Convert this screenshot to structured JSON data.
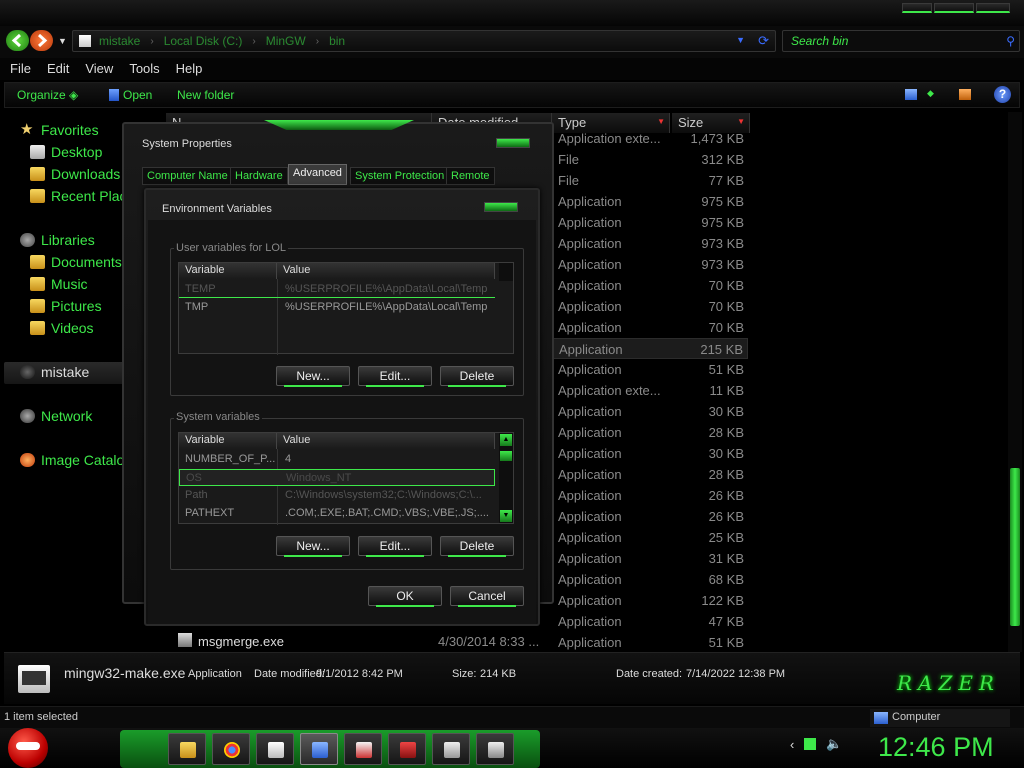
{
  "address": {
    "crumbs": [
      "mistake",
      "Local Disk (C:)",
      "MinGW",
      "bin"
    ],
    "search_placeholder": "Search bin"
  },
  "menu": [
    "File",
    "Edit",
    "View",
    "Tools",
    "Help"
  ],
  "commands": {
    "organize": "Organize",
    "open": "Open",
    "new_folder": "New folder"
  },
  "nav": {
    "favorites": "Favorites",
    "desktop": "Desktop",
    "downloads": "Downloads",
    "recent": "Recent Plac",
    "libraries": "Libraries",
    "documents": "Documents",
    "music": "Music",
    "pictures": "Pictures",
    "videos": "Videos",
    "user": "mistake",
    "network": "Network",
    "image_catalog": "Image Catalog"
  },
  "columns": {
    "name": "N",
    "date": "Date modified",
    "type": "Type",
    "size": "Size"
  },
  "files": [
    {
      "type": "Application exte...",
      "size": "1,473 KB"
    },
    {
      "type": "File",
      "size": "312 KB"
    },
    {
      "type": "File",
      "size": "77 KB"
    },
    {
      "type": "Application",
      "size": "975 KB"
    },
    {
      "type": "Application",
      "size": "975 KB"
    },
    {
      "type": "Application",
      "size": "973 KB"
    },
    {
      "type": "Application",
      "size": "973 KB"
    },
    {
      "type": "Application",
      "size": "70 KB"
    },
    {
      "type": "Application",
      "size": "70 KB"
    },
    {
      "type": "Application",
      "size": "70 KB"
    },
    {
      "type": "Application",
      "size": "215 KB"
    },
    {
      "type": "Application",
      "size": "51 KB"
    },
    {
      "type": "Application exte...",
      "size": "11 KB"
    },
    {
      "type": "Application",
      "size": "30 KB"
    },
    {
      "type": "Application",
      "size": "28 KB"
    },
    {
      "type": "Application",
      "size": "30 KB"
    },
    {
      "type": "Application",
      "size": "28 KB"
    },
    {
      "type": "Application",
      "size": "26 KB"
    },
    {
      "type": "Application",
      "size": "26 KB"
    },
    {
      "type": "Application",
      "size": "25 KB"
    },
    {
      "type": "Application",
      "size": "31 KB"
    },
    {
      "type": "Application",
      "size": "68 KB"
    },
    {
      "type": "Application",
      "size": "122 KB"
    },
    {
      "type": "Application",
      "size": "47 KB"
    },
    {
      "type": "Application",
      "size": "51 KB"
    }
  ],
  "msgmerge": {
    "name": "msgmerge.exe",
    "date": "4/30/2014 8:33 ..."
  },
  "details": {
    "filename": "mingw32-make.exe",
    "filetype": "Application",
    "date_modified_label": "Date modified:",
    "date_modified": "9/1/2012 8:42 PM",
    "size_label": "Size:",
    "size": "214 KB",
    "date_created_label": "Date created:",
    "date_created": "7/14/2022 12:38 PM",
    "logo": "RAZER"
  },
  "status": {
    "selected": "1 item selected",
    "computer": "Computer"
  },
  "clock": "12:46 PM",
  "sysprops": {
    "title": "System Properties",
    "tabs": [
      "Computer Name",
      "Hardware",
      "Advanced",
      "System Protection",
      "Remote"
    ]
  },
  "envvars": {
    "title": "Environment Variables",
    "user_label": "User variables for LOL",
    "system_label": "System variables",
    "col_variable": "Variable",
    "col_value": "Value",
    "user_rows": [
      {
        "var": "TEMP",
        "val": "%USERPROFILE%\\AppData\\Local\\Temp"
      },
      {
        "var": "TMP",
        "val": "%USERPROFILE%\\AppData\\Local\\Temp"
      }
    ],
    "system_rows": [
      {
        "var": "NUMBER_OF_P...",
        "val": "4"
      },
      {
        "var": "OS",
        "val": "Windows_NT"
      },
      {
        "var": "Path",
        "val": "C:\\Windows\\system32;C:\\Windows;C:\\..."
      },
      {
        "var": "PATHEXT",
        "val": ".COM;.EXE;.BAT;.CMD;.VBS;.VBE;.JS;...."
      }
    ],
    "new_label": "New...",
    "edit_label": "Edit...",
    "delete_label": "Delete",
    "ok_label": "OK",
    "cancel_label": "Cancel"
  }
}
